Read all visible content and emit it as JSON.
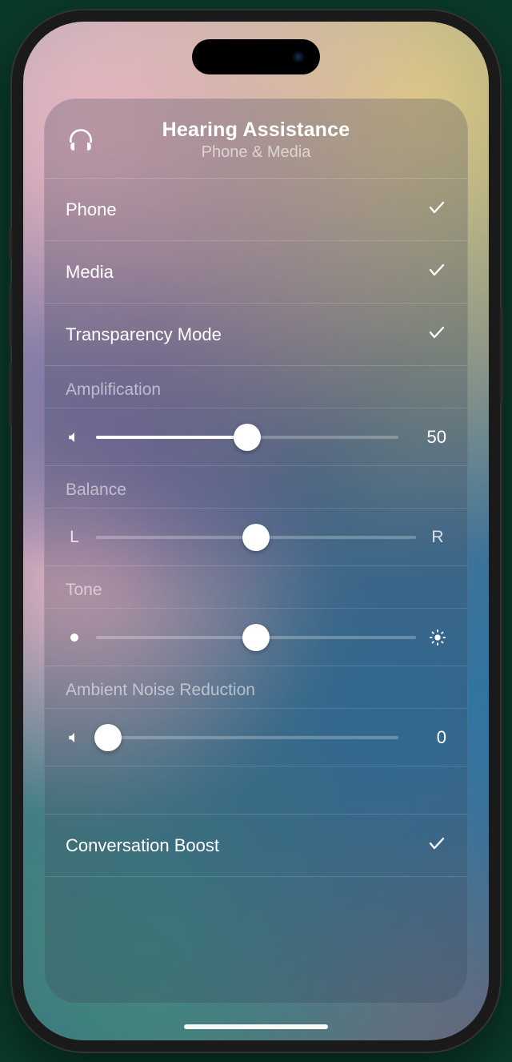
{
  "header": {
    "title": "Hearing Assistance",
    "subtitle": "Phone & Media"
  },
  "toggles": {
    "phone": {
      "label": "Phone",
      "checked": true
    },
    "media": {
      "label": "Media",
      "checked": true
    },
    "transparency": {
      "label": "Transparency Mode",
      "checked": true
    },
    "conversation_boost": {
      "label": "Conversation Boost",
      "checked": true
    }
  },
  "sliders": {
    "amplification": {
      "label": "Amplification",
      "value": 50,
      "display": "50",
      "min": 0,
      "max": 100
    },
    "balance": {
      "label": "Balance",
      "value": 50,
      "min": 0,
      "max": 100,
      "left_label": "L",
      "right_label": "R"
    },
    "tone": {
      "label": "Tone",
      "value": 50,
      "min": 0,
      "max": 100
    },
    "ambient_noise": {
      "label": "Ambient Noise Reduction",
      "value": 0,
      "display": "0",
      "min": 0,
      "max": 100
    }
  }
}
